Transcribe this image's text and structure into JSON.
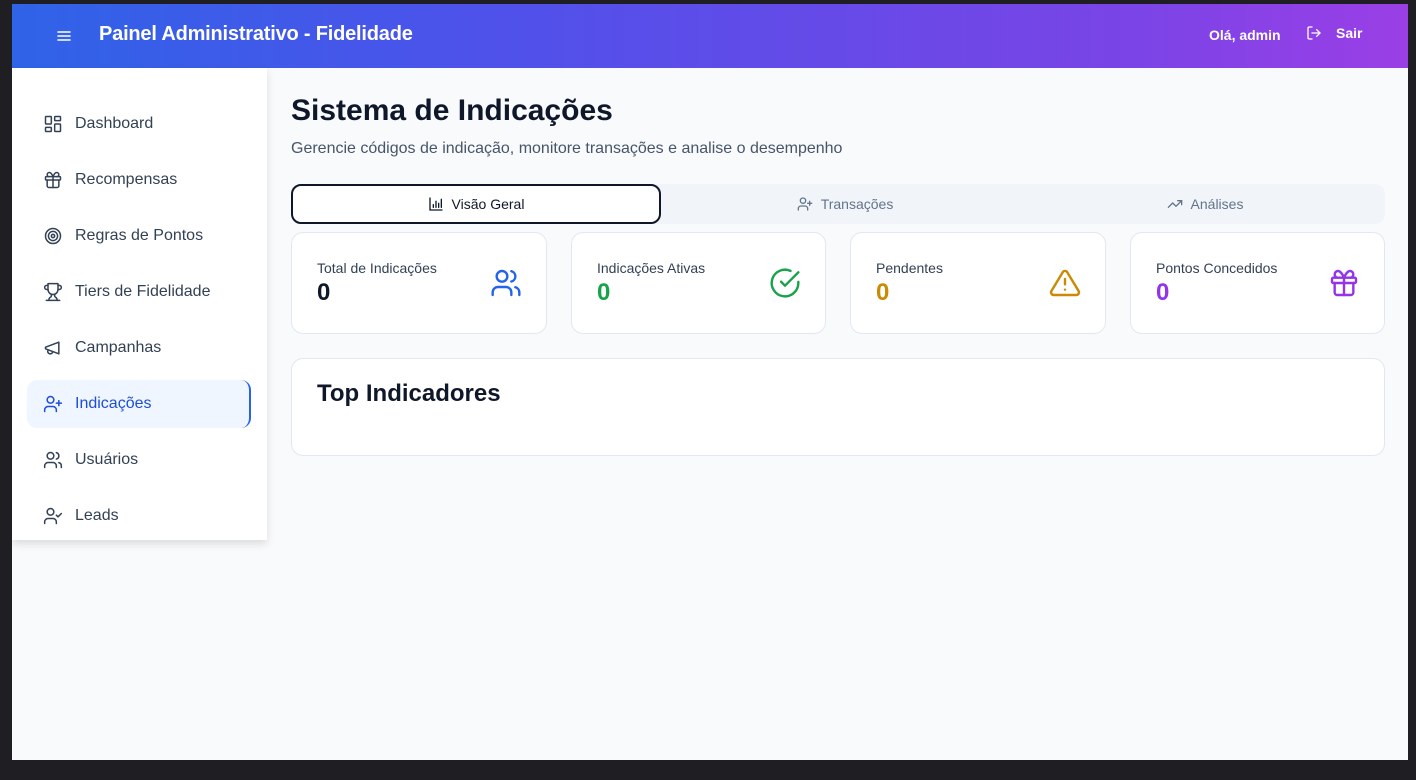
{
  "header": {
    "title": "Painel Administrativo - Fidelidade",
    "greeting": "Olá, admin",
    "logout_label": "Sair"
  },
  "sidebar": {
    "items": [
      {
        "label": "Dashboard",
        "icon": "dashboard-icon"
      },
      {
        "label": "Recompensas",
        "icon": "gift-icon"
      },
      {
        "label": "Regras de Pontos",
        "icon": "target-icon"
      },
      {
        "label": "Tiers de Fidelidade",
        "icon": "trophy-icon"
      },
      {
        "label": "Campanhas",
        "icon": "megaphone-icon"
      },
      {
        "label": "Indicações",
        "icon": "user-plus-icon",
        "active": true
      },
      {
        "label": "Usuários",
        "icon": "users-icon"
      },
      {
        "label": "Leads",
        "icon": "user-check-icon"
      }
    ]
  },
  "main": {
    "title": "Sistema de Indicações",
    "subtitle": "Gerencie códigos de indicação, monitore transações e analise o desempenho",
    "tabs": [
      {
        "label": "Visão Geral",
        "icon": "bar-chart-icon",
        "active": true
      },
      {
        "label": "Transações",
        "icon": "user-plus-icon"
      },
      {
        "label": "Análises",
        "icon": "trending-up-icon"
      }
    ],
    "stats": [
      {
        "label": "Total de Indicações",
        "value": "0",
        "color": "#0f172a",
        "icon_color": "#2563eb",
        "icon": "users-icon"
      },
      {
        "label": "Indicações Ativas",
        "value": "0",
        "color": "#16a34a",
        "icon_color": "#16a34a",
        "icon": "check-circle-icon"
      },
      {
        "label": "Pendentes",
        "value": "0",
        "color": "#ca8a04",
        "icon_color": "#ca8a04",
        "icon": "alert-triangle-icon"
      },
      {
        "label": "Pontos Concedidos",
        "value": "0",
        "color": "#9333ea",
        "icon_color": "#9333ea",
        "icon": "gift-icon"
      }
    ],
    "top_title": "Top Indicadores"
  }
}
